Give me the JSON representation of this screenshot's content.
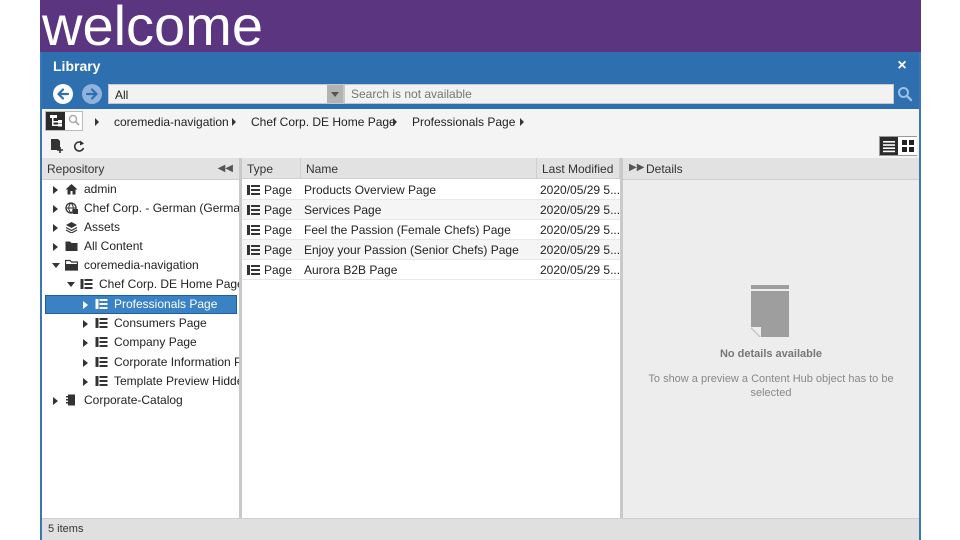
{
  "banner": {
    "text": "welcome"
  },
  "window": {
    "title": "Library",
    "close_label": "×"
  },
  "search": {
    "type_filter": "All",
    "placeholder": "Search is not available"
  },
  "breadcrumbs": [
    {
      "label": "coremedia-navigation"
    },
    {
      "label": "Chef Corp. DE Home Page"
    },
    {
      "label": "Professionals Page"
    }
  ],
  "tree": {
    "header": "Repository",
    "items": [
      {
        "label": "admin",
        "icon": "home-icon"
      },
      {
        "label": "Chef Corp. - German (Germany)",
        "icon": "globe-icon"
      },
      {
        "label": "Assets",
        "icon": "assets-icon"
      },
      {
        "label": "All Content",
        "icon": "folder-icon"
      },
      {
        "label": "coremedia-navigation",
        "icon": "folder-icon"
      },
      {
        "label": "Chef Corp. DE Home Page",
        "icon": "page-icon"
      },
      {
        "label": "Professionals Page",
        "icon": "page-icon"
      },
      {
        "label": "Consumers Page",
        "icon": "page-icon"
      },
      {
        "label": "Company Page",
        "icon": "page-icon"
      },
      {
        "label": "Corporate Information Page",
        "icon": "page-icon"
      },
      {
        "label": "Template Preview Hidden",
        "icon": "page-icon"
      },
      {
        "label": "Corporate-Catalog",
        "icon": "catalog-icon"
      }
    ]
  },
  "list": {
    "columns": {
      "type": "Type",
      "name": "Name",
      "modified": "Last Modified"
    },
    "rows": [
      {
        "type": "Page",
        "name": "Products Overview Page",
        "modified": "2020/05/29 5..."
      },
      {
        "type": "Page",
        "name": "Services Page",
        "modified": "2020/05/29 5..."
      },
      {
        "type": "Page",
        "name": "Feel the Passion (Female Chefs) Page",
        "modified": "2020/05/29 5..."
      },
      {
        "type": "Page",
        "name": "Enjoy your Passion (Senior Chefs) Page",
        "modified": "2020/05/29 5..."
      },
      {
        "type": "Page",
        "name": "Aurora B2B Page",
        "modified": "2020/05/29 5..."
      }
    ]
  },
  "details": {
    "header": "Details",
    "empty_title": "No details available",
    "empty_text": "To show a preview a Content Hub object has to be selected"
  },
  "status": {
    "count": "5 items"
  },
  "colors": {
    "accent": "#2e6fb0",
    "banner": "#5b3580",
    "selection": "#3a82c4"
  }
}
